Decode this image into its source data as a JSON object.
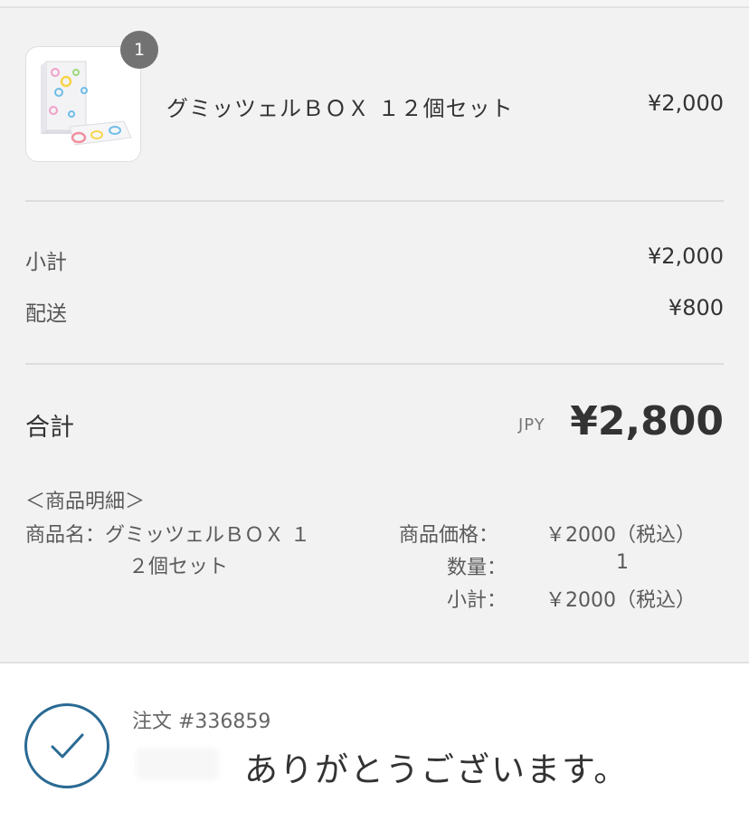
{
  "order_summary": {
    "item": {
      "quantity_badge": "1",
      "name": "グミッツェルＢＯＸ １２個セット",
      "price": "¥2,000",
      "thumbnail_icon": "product-box-image"
    },
    "subtotal": {
      "label": "小計",
      "value": "¥2,000"
    },
    "shipping": {
      "label": "配送",
      "value": "¥800"
    },
    "total": {
      "label": "合計",
      "currency": "JPY",
      "value": "¥2,800"
    },
    "details": {
      "heading": "＜商品明細＞",
      "name_line1": "商品名：グミッツェルＢＯＸ １",
      "name_line2": "２個セット",
      "price_label": "商品価格：",
      "price_value": "￥2000（税込）",
      "qty_label": "数量：",
      "qty_value": "1",
      "subtotal_label": "小計：",
      "subtotal_value": "￥2000（税込）"
    }
  },
  "confirmation": {
    "check_icon": "check-circle-icon",
    "order_number": "注文 #336859",
    "thank_you": "ありがとうございます。"
  },
  "colors": {
    "summary_bg": "#f2f2f2",
    "accent_check": "#2a6a94",
    "badge": "#727272"
  }
}
